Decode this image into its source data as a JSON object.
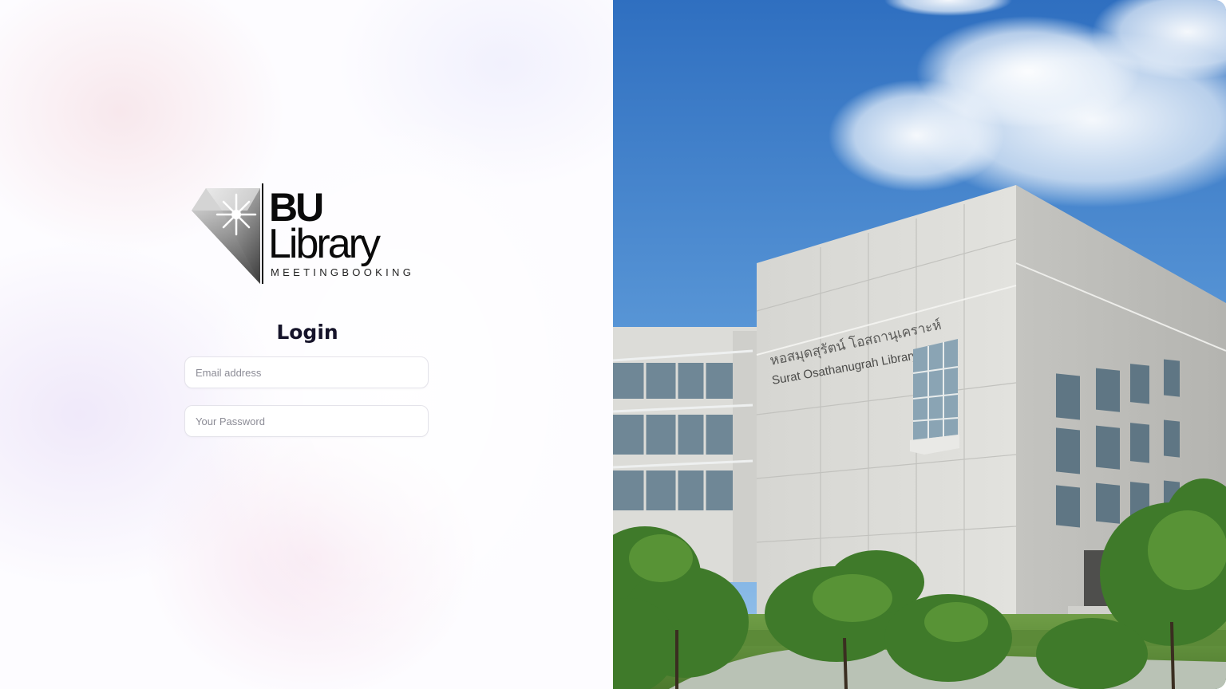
{
  "brand": {
    "logo_line1": "BU",
    "logo_line2": "Library",
    "logo_tagline": "MEETINGBOOKING"
  },
  "login": {
    "title": "Login",
    "email_placeholder": "Email address",
    "email_value": "",
    "password_placeholder": "Your Password",
    "password_value": ""
  },
  "photo": {
    "sign_thai": "หอสมุดสุรัตน์ โอสถานุเคราะห์",
    "sign_english": "Surat Osathanugrah Library"
  },
  "colors": {
    "title": "#16142a",
    "sky_top": "#2f6fc0",
    "sky_bottom": "#7eb3e4",
    "building": "#d9d9d6"
  },
  "icons": {
    "logo_mark": "diamond-star-icon"
  }
}
